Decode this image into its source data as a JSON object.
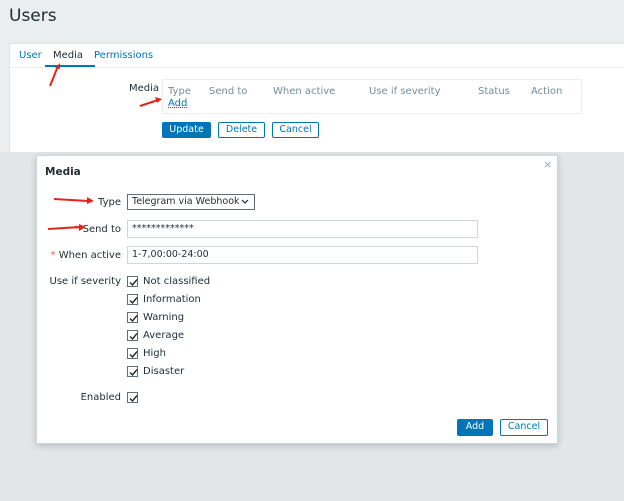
{
  "page": {
    "title": "Users"
  },
  "tabs": [
    {
      "label": "User"
    },
    {
      "label": "Media"
    },
    {
      "label": "Permissions"
    }
  ],
  "media_section": {
    "label": "Media",
    "columns": [
      "Type",
      "Send to",
      "When active",
      "Use if severity",
      "Status",
      "Action"
    ],
    "add_link": "Add"
  },
  "form_buttons": {
    "update": "Update",
    "delete": "Delete",
    "cancel": "Cancel"
  },
  "dialog": {
    "title": "Media",
    "close_symbol": "×",
    "type_label": "Type",
    "type_value": "Telegram via Webhook",
    "send_to_label": "Send to",
    "send_to_value": "*************",
    "when_active_label": "When active",
    "when_active_value": "1-7,00:00-24:00",
    "severity_label": "Use if severity",
    "severities": [
      {
        "label": "Not classified",
        "checked": true
      },
      {
        "label": "Information",
        "checked": true
      },
      {
        "label": "Warning",
        "checked": true
      },
      {
        "label": "Average",
        "checked": true
      },
      {
        "label": "High",
        "checked": true
      },
      {
        "label": "Disaster",
        "checked": true
      }
    ],
    "enabled_label": "Enabled",
    "enabled": true,
    "add_button": "Add",
    "cancel_button": "Cancel",
    "required_marker": "*"
  },
  "colors": {
    "accent": "#0275b8",
    "annotation_arrow": "#e0261c",
    "required": "#e45959"
  },
  "icons": {
    "annotation": "red-arrow-icon",
    "check": "checkmark-icon",
    "dropdown": "chevron-down-icon"
  }
}
